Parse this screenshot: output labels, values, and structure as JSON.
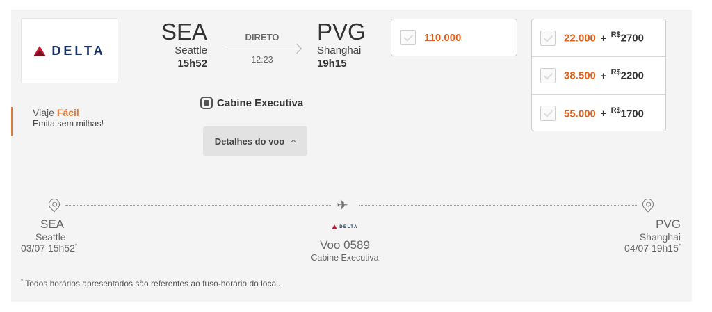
{
  "airline": {
    "name": "DELTA"
  },
  "promo": {
    "line1_prefix": "Viaje",
    "line1_accent": "Fácil",
    "line2": "Emita sem milhas!"
  },
  "origin": {
    "code": "SEA",
    "city": "Seattle",
    "time": "15h52"
  },
  "destination": {
    "code": "PVG",
    "city": "Shanghai",
    "time": "19h15"
  },
  "flight_info": {
    "type": "DIRETO",
    "duration": "12:23"
  },
  "cabin": {
    "label": "Cabine Executiva"
  },
  "details_button": {
    "label": "Detalhes do voo"
  },
  "fare_single": {
    "miles": "110.000"
  },
  "fare_options": [
    {
      "miles": "22.000",
      "plus": "+",
      "currency": "R$",
      "cash": "2700"
    },
    {
      "miles": "38.500",
      "plus": "+",
      "currency": "R$",
      "cash": "2200"
    },
    {
      "miles": "55.000",
      "plus": "+",
      "currency": "R$",
      "cash": "1700"
    }
  ],
  "route": {
    "origin": {
      "code": "SEA",
      "city": "Seattle",
      "datetime": "03/07 15h52",
      "mark": "*"
    },
    "destination": {
      "code": "PVG",
      "city": "Shanghai",
      "datetime": "04/07 19h15",
      "mark": "*"
    },
    "airline_name": "DELTA",
    "flight_number": "Voo 0589",
    "cabin": "Cabine Executiva"
  },
  "footnote": {
    "mark": "*",
    "text": "Todos horários apresentados são referentes ao fuso-horário do local."
  },
  "colors": {
    "accent": "#e0601b",
    "brand_red": "#c01933",
    "brand_navy": "#1b3463"
  }
}
